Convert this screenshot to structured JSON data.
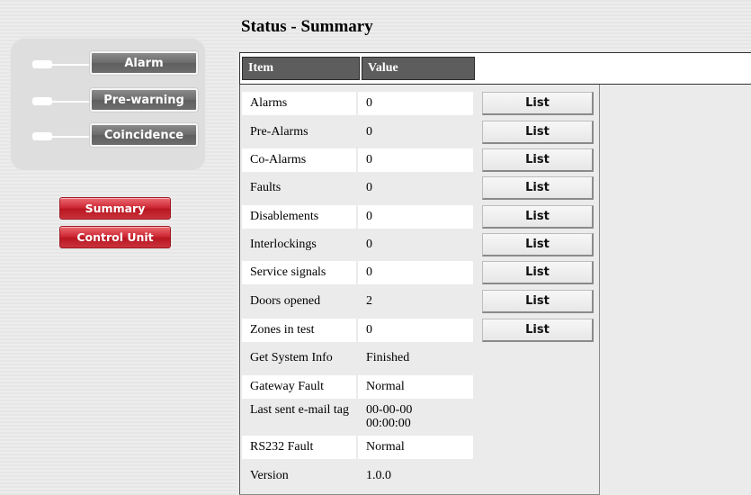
{
  "page": {
    "title": "Status - Summary"
  },
  "indicators": [
    {
      "label": "Alarm"
    },
    {
      "label": "Pre-warning"
    },
    {
      "label": "Coincidence"
    }
  ],
  "nav": [
    {
      "label": "Summary"
    },
    {
      "label": "Control Unit"
    }
  ],
  "table": {
    "headers": {
      "item": "Item",
      "value": "Value"
    },
    "list_label": "List",
    "rows": [
      {
        "item": "Alarms",
        "value": "0"
      },
      {
        "item": "Pre-Alarms",
        "value": "0"
      },
      {
        "item": "Co-Alarms",
        "value": "0"
      },
      {
        "item": "Faults",
        "value": "0"
      },
      {
        "item": "Disablements",
        "value": "0"
      },
      {
        "item": "Interlockings",
        "value": "0"
      },
      {
        "item": "Service signals",
        "value": "0"
      },
      {
        "item": "Doors opened",
        "value": "2"
      },
      {
        "item": "Zones in test",
        "value": "0"
      },
      {
        "item": "Get System Info",
        "value": "Finished"
      },
      {
        "item": "Gateway Fault",
        "value": "Normal"
      },
      {
        "item": "Last sent e-mail tag",
        "value": "00-00-00 00:00:00"
      },
      {
        "item": "RS232 Fault",
        "value": "Normal"
      },
      {
        "item": "Version",
        "value": "1.0.0"
      }
    ]
  },
  "colors": {
    "nav_red": "#cf2a36",
    "indicator_gray": "#6d6d6d",
    "header_gray": "#5d5d5d"
  }
}
